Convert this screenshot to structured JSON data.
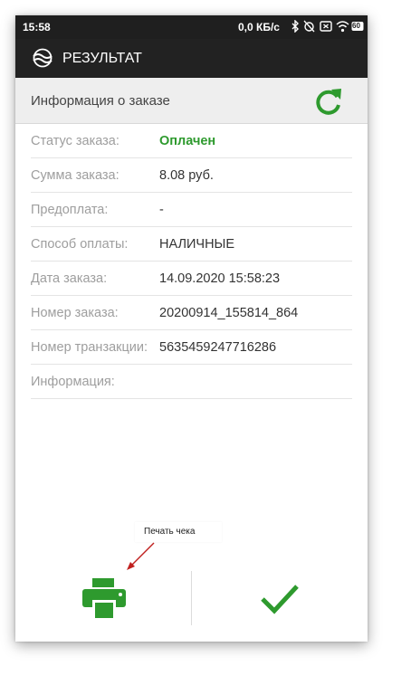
{
  "status_bar": {
    "time": "15:58",
    "speed": "0,0 КБ/с",
    "battery": "60",
    "icons": [
      "bluetooth-icon",
      "alarm-icon",
      "sim-icon",
      "wifi-icon",
      "battery-icon"
    ]
  },
  "app_bar": {
    "title": "РЕЗУЛЬТАТ",
    "logo_icon": "logo-icon"
  },
  "header": {
    "title": "Информация о заказе",
    "refresh_icon": "refresh-icon",
    "accent_color": "#2e9a2e"
  },
  "details": [
    {
      "label": "Статус заказа:",
      "value": "Оплачен"
    },
    {
      "label": "Сумма заказа:",
      "value": "8.08 руб."
    },
    {
      "label": "Предоплата:",
      "value": "-"
    },
    {
      "label": "Способ оплаты:",
      "value": "НАЛИЧНЫЕ"
    },
    {
      "label": "Дата заказа:",
      "value": "14.09.2020 15:58:23"
    },
    {
      "label": "Номер заказа:",
      "value": "20200914_155814_864"
    },
    {
      "label": "Номер транзакции:",
      "value": "5635459247716286"
    },
    {
      "label": "Информация:",
      "value": ""
    }
  ],
  "annotation": {
    "text": "Печать чека",
    "arrow_color": "#c0201f"
  },
  "footer": {
    "print_icon": "printer-icon",
    "confirm_icon": "checkmark-icon"
  }
}
